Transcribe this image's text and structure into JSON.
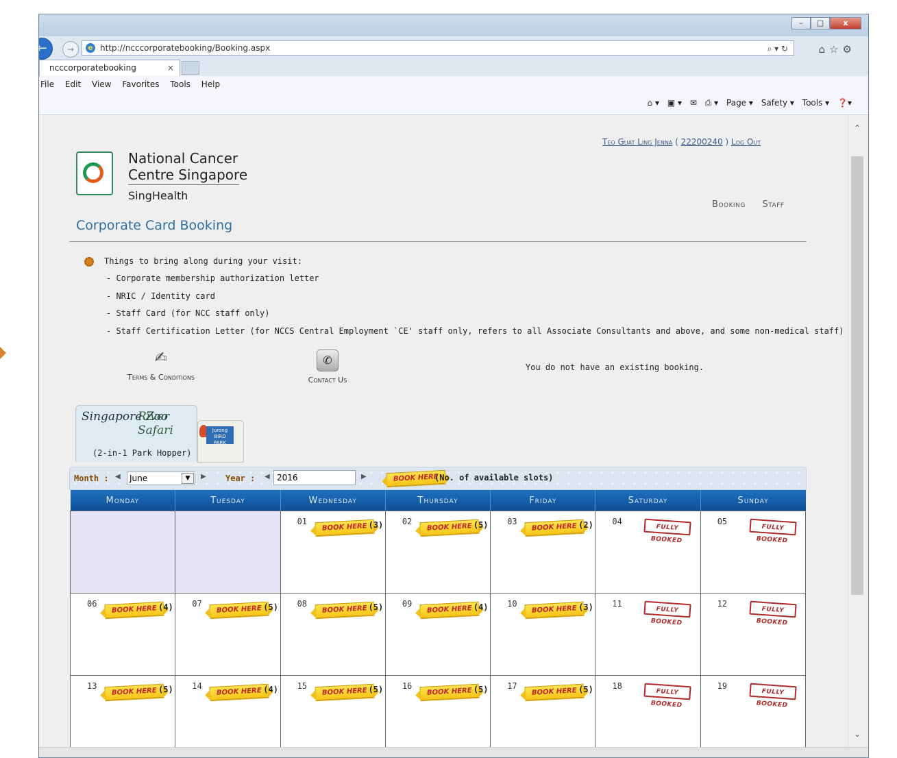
{
  "browser": {
    "url": "http://ncccorporatebooking/Booking.aspx",
    "tab_title": "ncccorporatebooking",
    "tab_close": "×",
    "addr_tools": "⌕ ▾ ↻",
    "menu": [
      "File",
      "Edit",
      "View",
      "Favorites",
      "Tools",
      "Help"
    ],
    "commands": [
      "Page ▾",
      "Safety ▾",
      "Tools ▾"
    ],
    "window_controls": [
      "–",
      "□",
      "x"
    ]
  },
  "user": {
    "name": "Teo Guat Ling Jenna",
    "open_paren": "(",
    "id": "22200240",
    "close_paren": ")",
    "logout": "Log Out"
  },
  "brand": {
    "line1": "National Cancer",
    "line2": "Centre Singapore",
    "line3": "SingHealth"
  },
  "nav": [
    "Booking",
    "Staff"
  ],
  "page_title": "Corporate Card Booking",
  "info": {
    "title": "Things to bring along during your visit:",
    "items": [
      "-  Corporate membership authorization letter",
      "-  NRIC / Identity card",
      "-  Staff Card (for NCC staff only)",
      "-  Staff Certification Letter (for NCCS Central Employment `CE' staff only, refers to all Associate Consultants and above, and some non-medical staff)"
    ]
  },
  "links": {
    "terms": "Terms & Conditions",
    "contact": "Contact Us"
  },
  "booking_status": "You do not have an existing booking.",
  "parks": {
    "zoo_logo": "Singapore Zoo",
    "river_logo": "River Safari",
    "caption": "(2-in-1 Park Hopper)",
    "bird_logo_1": "Jurong",
    "bird_logo_2": "BIRD",
    "bird_logo_3": "PARK"
  },
  "controls": {
    "month_label": "Month :",
    "month_value": "June",
    "year_label": "Year :",
    "year_value": "2016",
    "legend_text": "(No. of available slots)",
    "book_here": "BOOK HERE",
    "fully_booked": "FULLY BOOKED"
  },
  "calendar": {
    "weekdays": [
      "Monday",
      "Tuesday",
      "Wednesday",
      "Thursday",
      "Friday",
      "Saturday",
      "Sunday"
    ],
    "weeks": [
      [
        {
          "day": "",
          "status": "empty",
          "slots": ""
        },
        {
          "day": "",
          "status": "empty",
          "slots": ""
        },
        {
          "day": "01",
          "status": "book",
          "slots": "(3)"
        },
        {
          "day": "02",
          "status": "book",
          "slots": "(5)"
        },
        {
          "day": "03",
          "status": "book",
          "slots": "(2)"
        },
        {
          "day": "04",
          "status": "full",
          "slots": ""
        },
        {
          "day": "05",
          "status": "full",
          "slots": ""
        }
      ],
      [
        {
          "day": "06",
          "status": "book",
          "slots": "(4)"
        },
        {
          "day": "07",
          "status": "book",
          "slots": "(5)"
        },
        {
          "day": "08",
          "status": "book",
          "slots": "(5)"
        },
        {
          "day": "09",
          "status": "book",
          "slots": "(4)"
        },
        {
          "day": "10",
          "status": "book",
          "slots": "(3)"
        },
        {
          "day": "11",
          "status": "full",
          "slots": ""
        },
        {
          "day": "12",
          "status": "full",
          "slots": ""
        }
      ],
      [
        {
          "day": "13",
          "status": "book",
          "slots": "(5)"
        },
        {
          "day": "14",
          "status": "book",
          "slots": "(4)"
        },
        {
          "day": "15",
          "status": "book",
          "slots": "(5)"
        },
        {
          "day": "16",
          "status": "book",
          "slots": "(5)"
        },
        {
          "day": "17",
          "status": "book",
          "slots": "(5)"
        },
        {
          "day": "18",
          "status": "full",
          "slots": ""
        },
        {
          "day": "19",
          "status": "full",
          "slots": ""
        }
      ]
    ]
  },
  "colors": {
    "header_blue": "#0d4f96",
    "title_blue": "#2f6f9f",
    "ribbon_yellow": "#f7c519",
    "stamp_red": "#b02a2a",
    "empty_cell": "#e4e4f6"
  }
}
